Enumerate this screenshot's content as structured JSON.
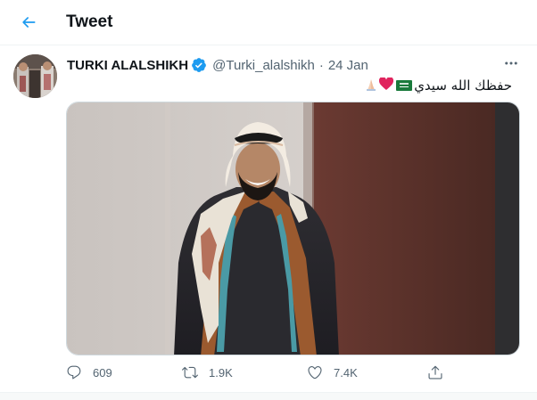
{
  "header": {
    "title": "Tweet",
    "back_icon": "arrow-left-icon",
    "accent": "#1d9bf0"
  },
  "tweet": {
    "author_name": "TURKI ALALSHIKH",
    "verified": true,
    "handle": "@Turki_alalshikh",
    "separator": "·",
    "date": "24 Jan",
    "text": "حفظك الله سيدي",
    "emojis": [
      "saudi-flag-icon",
      "red-heart-icon",
      "folded-hands-icon"
    ],
    "more_icon": "more-horizontal-icon",
    "actions": {
      "reply_count": "609",
      "retweet_count": "1.9K",
      "like_count": "7.4K"
    }
  },
  "colors": {
    "text": "#0f1419",
    "secondary": "#536471",
    "verified": "#1d9bf0",
    "border": "#eff3f4"
  }
}
